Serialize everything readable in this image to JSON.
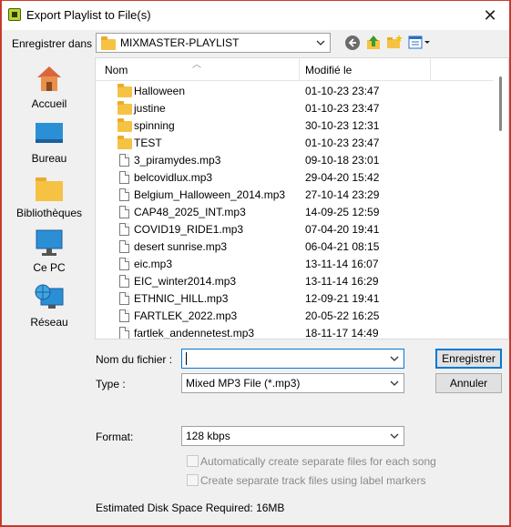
{
  "window": {
    "title": "Export Playlist to File(s)",
    "close_glyph": "✕"
  },
  "location": {
    "label": "Enregistrer dans :",
    "value": "MIXMASTER-PLAYLIST"
  },
  "places": [
    {
      "label": "Accueil",
      "icon": "home-icon"
    },
    {
      "label": "Bureau",
      "icon": "desktop-icon"
    },
    {
      "label": "Bibliothèques",
      "icon": "libraries-icon"
    },
    {
      "label": "Ce PC",
      "icon": "computer-icon"
    },
    {
      "label": "Réseau",
      "icon": "network-icon"
    }
  ],
  "columns": {
    "name": "Nom",
    "modified": "Modifié le"
  },
  "files": [
    {
      "name": "Halloween",
      "date": "01-10-23 23:47",
      "kind": "folder"
    },
    {
      "name": "justine",
      "date": "01-10-23 23:47",
      "kind": "folder"
    },
    {
      "name": "spinning",
      "date": "30-10-23 12:31",
      "kind": "folder"
    },
    {
      "name": "TEST",
      "date": "01-10-23 23:47",
      "kind": "folder"
    },
    {
      "name": "3_piramydes.mp3",
      "date": "09-10-18 23:01",
      "kind": "file"
    },
    {
      "name": "belcovidlux.mp3",
      "date": "29-04-20 15:42",
      "kind": "file"
    },
    {
      "name": "Belgium_Halloween_2014.mp3",
      "date": "27-10-14 23:29",
      "kind": "file"
    },
    {
      "name": "CAP48_2025_INT.mp3",
      "date": "14-09-25 12:59",
      "kind": "file"
    },
    {
      "name": "COVID19_RIDE1.mp3",
      "date": "07-04-20 19:41",
      "kind": "file"
    },
    {
      "name": "desert sunrise.mp3",
      "date": "06-04-21 08:15",
      "kind": "file"
    },
    {
      "name": "eic.mp3",
      "date": "13-11-14 16:07",
      "kind": "file"
    },
    {
      "name": "EIC_winter2014.mp3",
      "date": "13-11-14 16:29",
      "kind": "file"
    },
    {
      "name": "ETHNIC_HILL.mp3",
      "date": "12-09-21 19:41",
      "kind": "file"
    },
    {
      "name": "FARTLEK_2022.mp3",
      "date": "20-05-22 16:25",
      "kind": "file"
    },
    {
      "name": "fartlek_andennetest.mp3",
      "date": "18-11-17 14:49",
      "kind": "file"
    }
  ],
  "filename": {
    "label": "Nom du fichier :",
    "value": ""
  },
  "filetype": {
    "label": "Type :",
    "value": "Mixed MP3 File (*.mp3)"
  },
  "buttons": {
    "save": "Enregistrer",
    "cancel": "Annuler"
  },
  "format": {
    "label": "Format:",
    "value": "128 kbps"
  },
  "options": [
    {
      "label": "Automatically create separate files for each song",
      "checked": false,
      "enabled": false
    },
    {
      "label": "Create separate track files using label markers",
      "checked": false,
      "enabled": false
    }
  ],
  "disk_space": "Estimated Disk Space Required: 16MB"
}
